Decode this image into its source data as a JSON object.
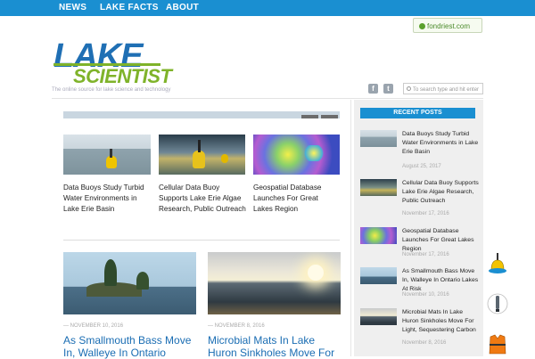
{
  "nav": {
    "items": [
      {
        "label": "NEWS"
      },
      {
        "label": "LAKE FACTS"
      },
      {
        "label": "ABOUT"
      }
    ]
  },
  "header": {
    "logo_top": "LAKE",
    "logo_bottom": "SCIENTIST",
    "tagline": "The online source for lake science and technology",
    "fondriest_link": "fondriest.com",
    "search_placeholder": "To search type and hit enter"
  },
  "featured": [
    {
      "title": "Data Buoys Study Turbid Water Environments in Lake Erie Basin"
    },
    {
      "title": "Cellular Data Buoy Supports Lake Erie Algae Research, Public Outreach"
    },
    {
      "title": "Geospatial Database Launches For Great Lakes Region"
    }
  ],
  "articles": [
    {
      "date": "— NOVEMBER 10, 2016",
      "title": "As Smallmouth Bass Move In, Walleye In Ontario"
    },
    {
      "date": "— NOVEMBER 8, 2016",
      "title": "Microbial Mats In Lake Huron Sinkholes Move For"
    }
  ],
  "sidebar": {
    "heading": "RECENT POSTS",
    "posts": [
      {
        "title": "Data Buoys Study Turbid Water Environments in Lake Erie Basin",
        "date": "August 25, 2017"
      },
      {
        "title": "Cellular Data Buoy Supports Lake Erie Algae Research, Public Outreach",
        "date": "November 17, 2016"
      },
      {
        "title": "Geospatial Database Launches For Great Lakes Region",
        "date": "November 17, 2016"
      },
      {
        "title": "As Smallmouth Bass Move In, Walleye In Ontario Lakes At Risk",
        "date": "November 10, 2016"
      },
      {
        "title": "Microbial Mats In Lake Huron Sinkholes Move For Light, Sequestering Carbon",
        "date": "November 8, 2016"
      }
    ]
  },
  "icons": {
    "social": [
      "facebook-icon",
      "twitter-icon"
    ],
    "floating": [
      "buoy-icon",
      "sensor-probe-icon",
      "life-vest-icon"
    ]
  },
  "colors": {
    "nav_bar": "#1a8fd1",
    "logo_blue": "#1f6fb4",
    "logo_green": "#7fb32a",
    "link_blue": "#1a6db3"
  }
}
